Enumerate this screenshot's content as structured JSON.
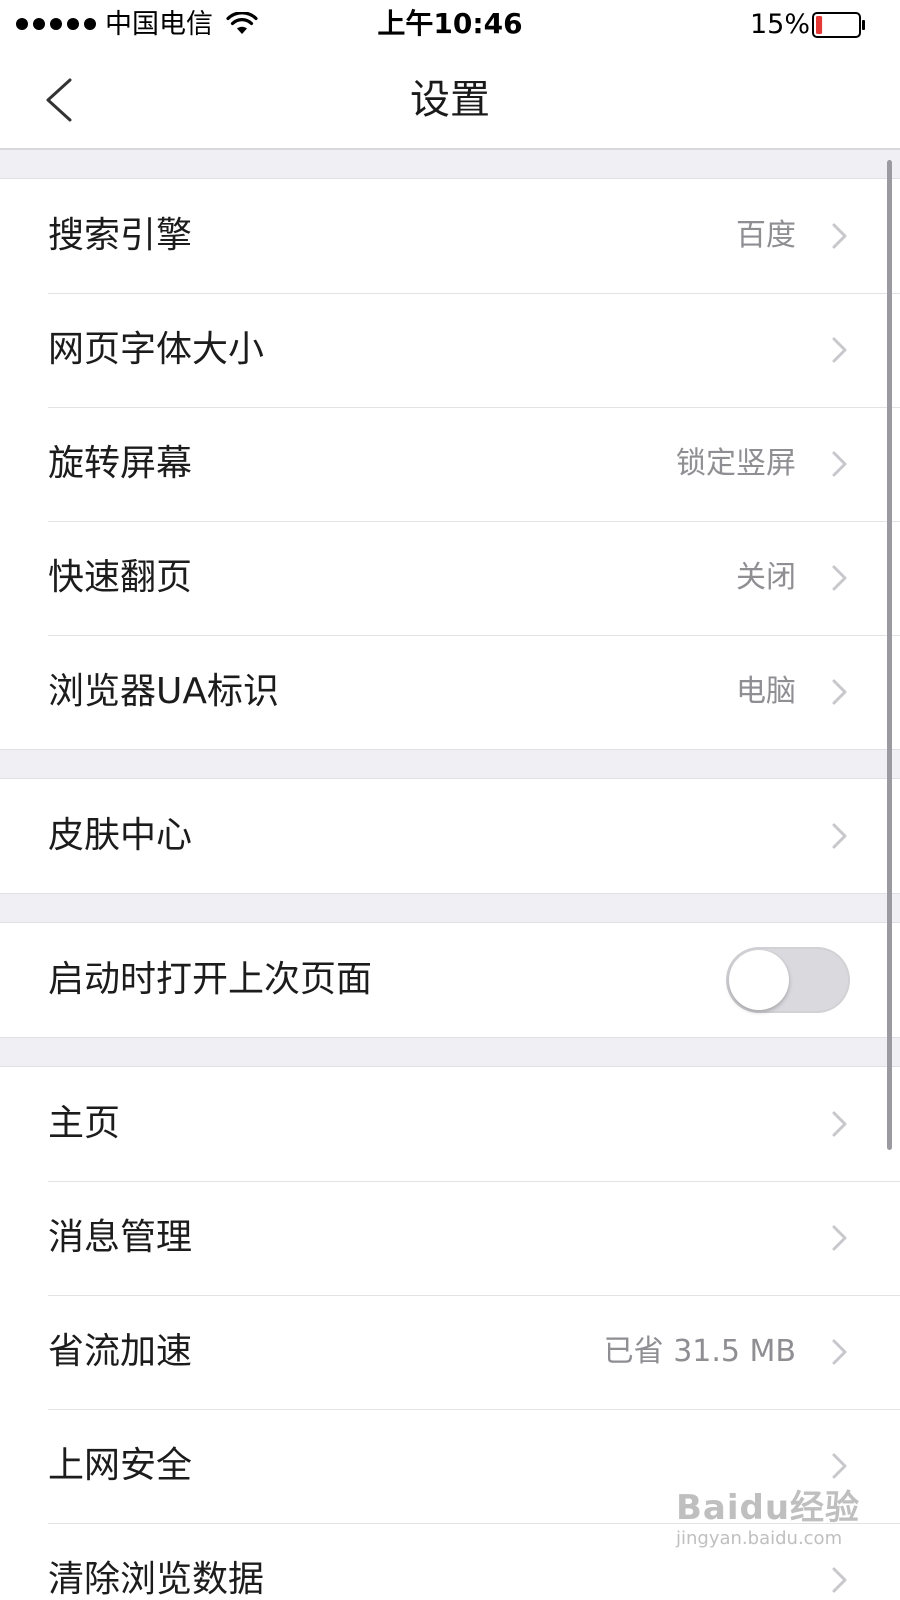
{
  "status_bar": {
    "carrier": "中国电信",
    "time": "上午10:46",
    "battery_percent": "15%",
    "battery_level": 0.15,
    "battery_color": "#e53935",
    "wifi_icon": "wifi-icon",
    "signal_icon": "signal-dots-icon"
  },
  "nav": {
    "back_icon": "chevron-left-icon",
    "title": "设置"
  },
  "groups": [
    {
      "rows": [
        {
          "label": "搜索引擎",
          "value": "百度"
        },
        {
          "label": "网页字体大小",
          "value": ""
        },
        {
          "label": "旋转屏幕",
          "value": "锁定竖屏"
        },
        {
          "label": "快速翻页",
          "value": "关闭"
        },
        {
          "label": "浏览器UA标识",
          "value": "电脑"
        }
      ]
    },
    {
      "rows": [
        {
          "label": "皮肤中心",
          "value": ""
        }
      ]
    },
    {
      "rows": [
        {
          "label": "启动时打开上次页面",
          "toggle": false
        }
      ]
    },
    {
      "rows": [
        {
          "label": "主页",
          "value": ""
        },
        {
          "label": "消息管理",
          "value": ""
        },
        {
          "label": "省流加速",
          "value": "已省 31.5 MB"
        },
        {
          "label": "上网安全",
          "value": ""
        },
        {
          "label": "清除浏览数据",
          "value": ""
        }
      ]
    }
  ],
  "watermark": {
    "logo": "Baidu经验",
    "url": "jingyan.baidu.com"
  },
  "colors": {
    "background": "#efeff4",
    "value_text": "#8e8e93",
    "chevron": "#c7c7cc"
  }
}
